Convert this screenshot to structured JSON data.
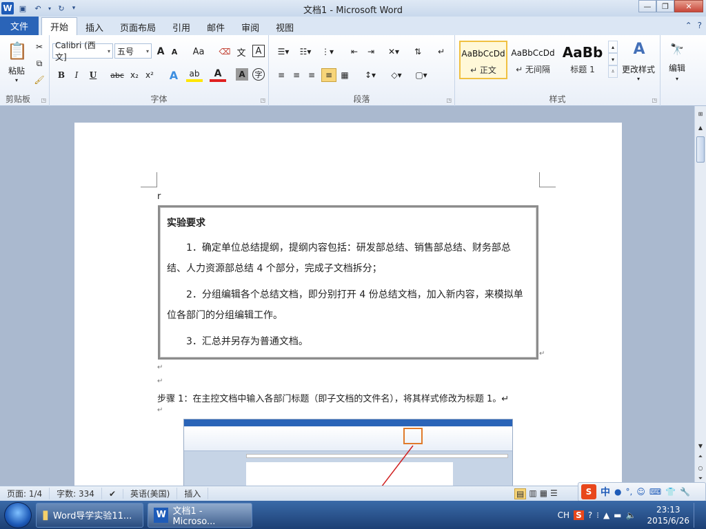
{
  "window": {
    "title": "文档1 - Microsoft Word"
  },
  "tabs": [
    {
      "label": "文件"
    },
    {
      "label": "开始"
    },
    {
      "label": "插入"
    },
    {
      "label": "页面布局"
    },
    {
      "label": "引用"
    },
    {
      "label": "邮件"
    },
    {
      "label": "审阅"
    },
    {
      "label": "视图"
    }
  ],
  "ribbon": {
    "clipboard": {
      "paste": "粘贴",
      "label": "剪贴板"
    },
    "font": {
      "name": "Calibri (西文]",
      "size": "五号",
      "label": "字体",
      "bold": "B",
      "italic": "I",
      "underline": "U",
      "strike": "abc",
      "sub": "x₂",
      "sup": "x²",
      "grow": "A",
      "shrink": "A",
      "case": "Aa"
    },
    "paragraph": {
      "label": "段落"
    },
    "styles": {
      "label": "样式",
      "items": [
        {
          "sample": "AaBbCcDd",
          "name": "↵ 正文"
        },
        {
          "sample": "AaBbCcDd",
          "name": "↵ 无间隔"
        },
        {
          "sample": "AaBb",
          "name": "标题 1"
        }
      ],
      "change": "更改样式"
    },
    "editing": {
      "label": "编辑"
    }
  },
  "document": {
    "r_mark": "r",
    "box_title": "实验要求",
    "items": [
      "1．确定单位总结提纲，提纲内容包括：研发部总结、销售部总结、财务部总结、人力资源部总结 4 个部分，完成子文档拆分；",
      "2．分组编辑各个总结文档，即分别打开 4 份总结文档，加入新内容，来模拟单位各部门的分组编辑工作。",
      "3．汇总并另存为普通文档。"
    ],
    "step1": "步骤 1：在主控文档中输入各部门标题（即子文档的文件名），将其样式修改为标题 1。↵",
    "para_mark": "↵"
  },
  "statusbar": {
    "page": "页面: 1/4",
    "words": "字数: 334",
    "lang": "英语(美国)",
    "mode": "插入"
  },
  "taskbar": {
    "tasks": [
      {
        "label": "Word导学实验11..."
      },
      {
        "label": "文档1 - Microso..."
      }
    ],
    "time": "23:13",
    "date": "2015/6/26",
    "lang": "CH"
  },
  "ime": {
    "mode": "中"
  }
}
